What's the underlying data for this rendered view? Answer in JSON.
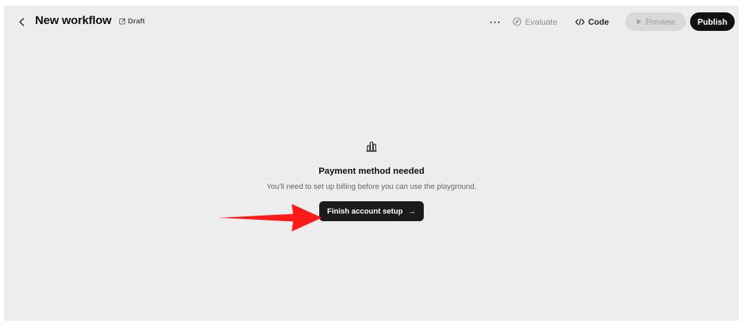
{
  "header": {
    "title": "New workflow",
    "draft_label": "Draft",
    "more_label": "···",
    "evaluate_label": "Evaluate",
    "code_label": "Code",
    "preview_label": "Preview",
    "publish_label": "Publish"
  },
  "empty_state": {
    "heading": "Payment method needed",
    "message": "You'll need to set up billing before you can use the playground.",
    "button_label": "Finish account setup",
    "button_arrow": "→"
  },
  "colors": {
    "canvas": "#ededed",
    "primary": "#111111",
    "annotation_arrow": "#ff1a1a"
  },
  "icons": [
    "chevron-left-icon",
    "edit-icon",
    "more-icon",
    "compass-icon",
    "code-icon",
    "play-icon",
    "bar-chart-icon",
    "arrow-right-icon"
  ]
}
